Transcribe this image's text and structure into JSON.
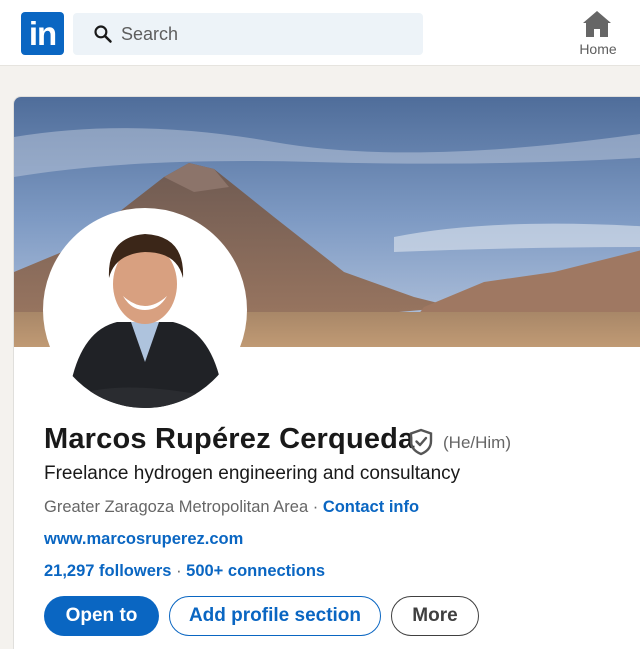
{
  "nav": {
    "logo_text": "in",
    "search_placeholder": "Search",
    "home_label": "Home"
  },
  "profile": {
    "name": "Marcos Rupérez Cerqueda",
    "pronouns": "(He/Him)",
    "headline": "Freelance hydrogen engineering and consultancy",
    "location": "Greater Zaragoza Metropolitan Area",
    "location_separator": " · ",
    "contact_info": "Contact info",
    "website": "www.marcosruperez.com",
    "followers": "21,297 followers",
    "network_separator": " · ",
    "connections": "500+ connections"
  },
  "actions": {
    "open_to": "Open to",
    "add_section": "Add profile section",
    "more": "More"
  },
  "colors": {
    "brand": "#0a66c2",
    "page_bg": "#f4f2ee",
    "muted_text": "#666666"
  },
  "icons": {
    "search": "search-icon",
    "home": "home-icon",
    "verify": "verified-shield-icon"
  }
}
